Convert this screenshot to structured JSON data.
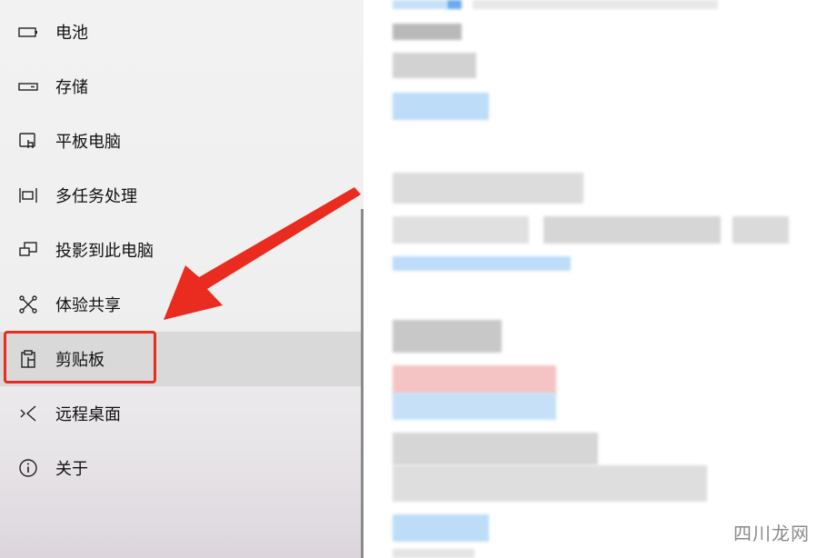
{
  "sidebar": {
    "items": [
      {
        "label": "电池",
        "icon": "battery-icon"
      },
      {
        "label": "存储",
        "icon": "storage-icon"
      },
      {
        "label": "平板电脑",
        "icon": "tablet-icon"
      },
      {
        "label": "多任务处理",
        "icon": "multitasking-icon"
      },
      {
        "label": "投影到此电脑",
        "icon": "projecting-icon"
      },
      {
        "label": "体验共享",
        "icon": "shared-experiences-icon"
      },
      {
        "label": "剪贴板",
        "icon": "clipboard-icon",
        "selected": true
      },
      {
        "label": "远程桌面",
        "icon": "remote-desktop-icon"
      },
      {
        "label": "关于",
        "icon": "info-icon"
      }
    ]
  },
  "annotation": {
    "color": "#ea2b20"
  },
  "watermark": "四川龙网",
  "colors": {
    "selected_bg": "#d9d9d9",
    "link_blue": "#bcdcf8",
    "pink": "#f4c4c4"
  }
}
